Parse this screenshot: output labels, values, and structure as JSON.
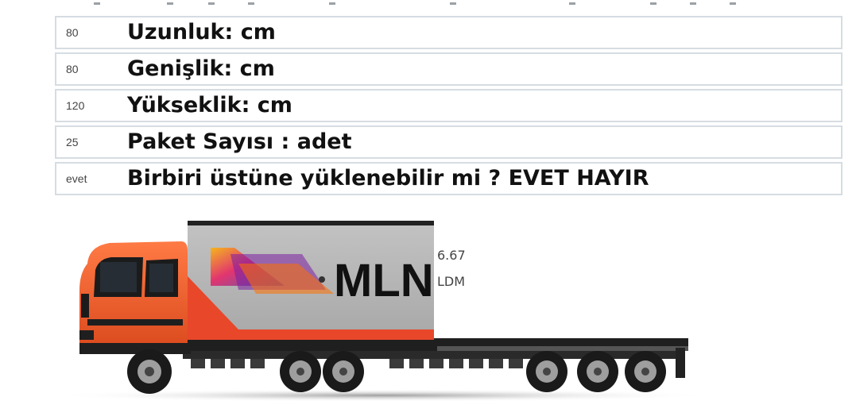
{
  "form": {
    "rows": [
      {
        "value": "80",
        "label": "Uzunluk: cm"
      },
      {
        "value": "80",
        "label": "Genişlik: cm"
      },
      {
        "value": "120",
        "label": "Yükseklik: cm"
      },
      {
        "value": "25",
        "label": "Paket Sayısı : adet"
      },
      {
        "value": "evet",
        "label": "Birbiri üstüne yüklenebilir mi ? EVET HAYIR"
      }
    ]
  },
  "result": {
    "ldm_value": "6.67",
    "ldm_unit": "LDM"
  },
  "truck": {
    "logo_text": "MLN",
    "cab_color": "#f05a28",
    "box_color": "#b3b3b3",
    "accent_color": "#e8472a"
  }
}
